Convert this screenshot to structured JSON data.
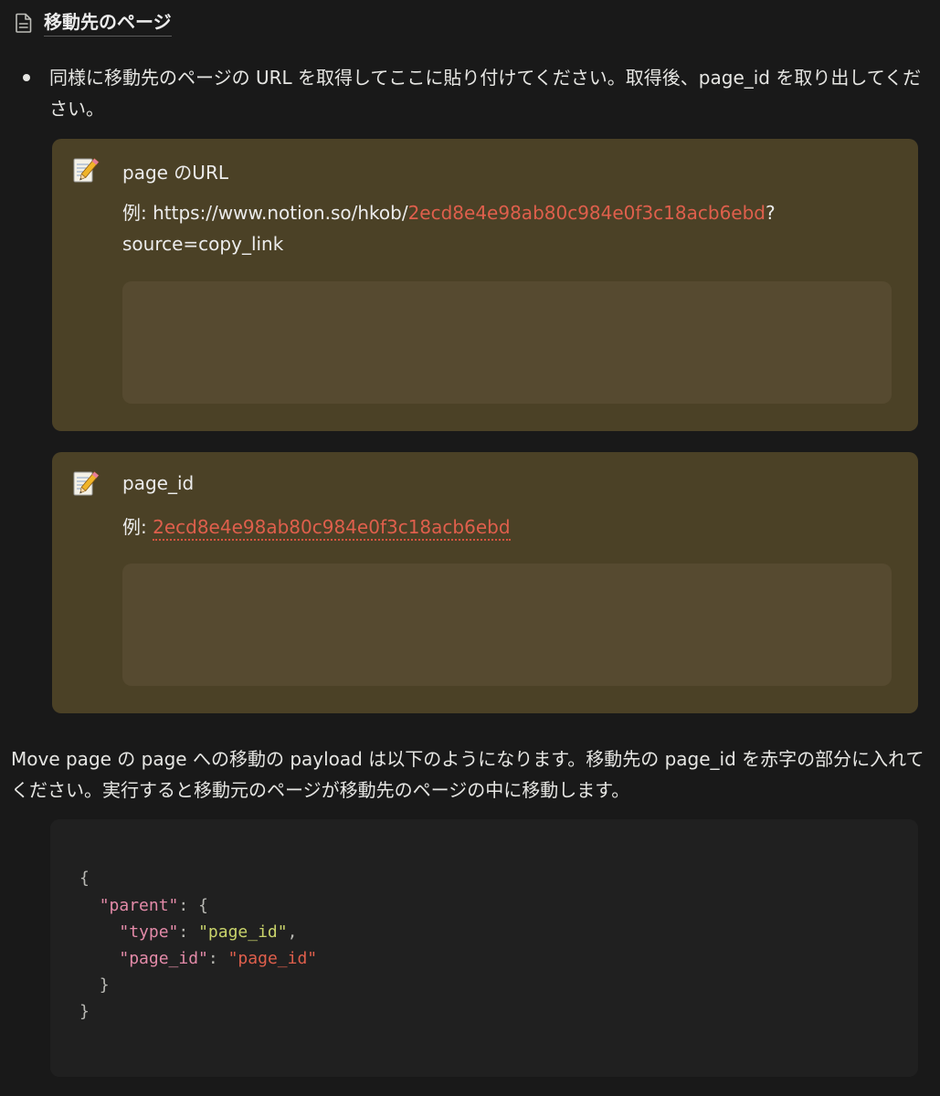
{
  "page_link": {
    "icon": "page-document-icon",
    "title": "移動先のページ"
  },
  "bullet": {
    "text": "同様に移動先のページの URL を取得してここに貼り付けてください。取得後、page_id を取り出してください。"
  },
  "callout_url": {
    "icon": "memo-pencil-icon",
    "heading": "page のURL",
    "example_prefix": "例: https://www.notion.so/hkob/",
    "example_id": "2ecd8e4e98ab80c984e0f3c18acb6ebd",
    "example_suffix": "?source=copy_link",
    "input_value": ""
  },
  "callout_page_id": {
    "icon": "memo-pencil-icon",
    "heading": "page_id",
    "example_prefix": "例: ",
    "example_id": "2ecd8e4e98ab80c984e0f3c18acb6ebd",
    "input_value": ""
  },
  "paragraph": {
    "text": "Move page の page への移動の payload は以下のようになります。移動先の page_id を赤字の部分に入れてください。実行すると移動元のページが移動先のページの中に移動します。"
  },
  "code": {
    "open_brace": "{",
    "parent_key": "\"parent\"",
    "type_key": "\"type\"",
    "type_value": "\"page_id\"",
    "page_id_key": "\"page_id\"",
    "page_id_value": "\"page_id\"",
    "inner_close": "}",
    "outer_close": "}"
  },
  "colors": {
    "background": "#191919",
    "callout_bg": "#4b4126",
    "input_bg": "#564a30",
    "code_bg": "#202020",
    "red_text": "#df5f4c",
    "code_key": "#e38aa8",
    "code_string": "#c9d36b"
  }
}
